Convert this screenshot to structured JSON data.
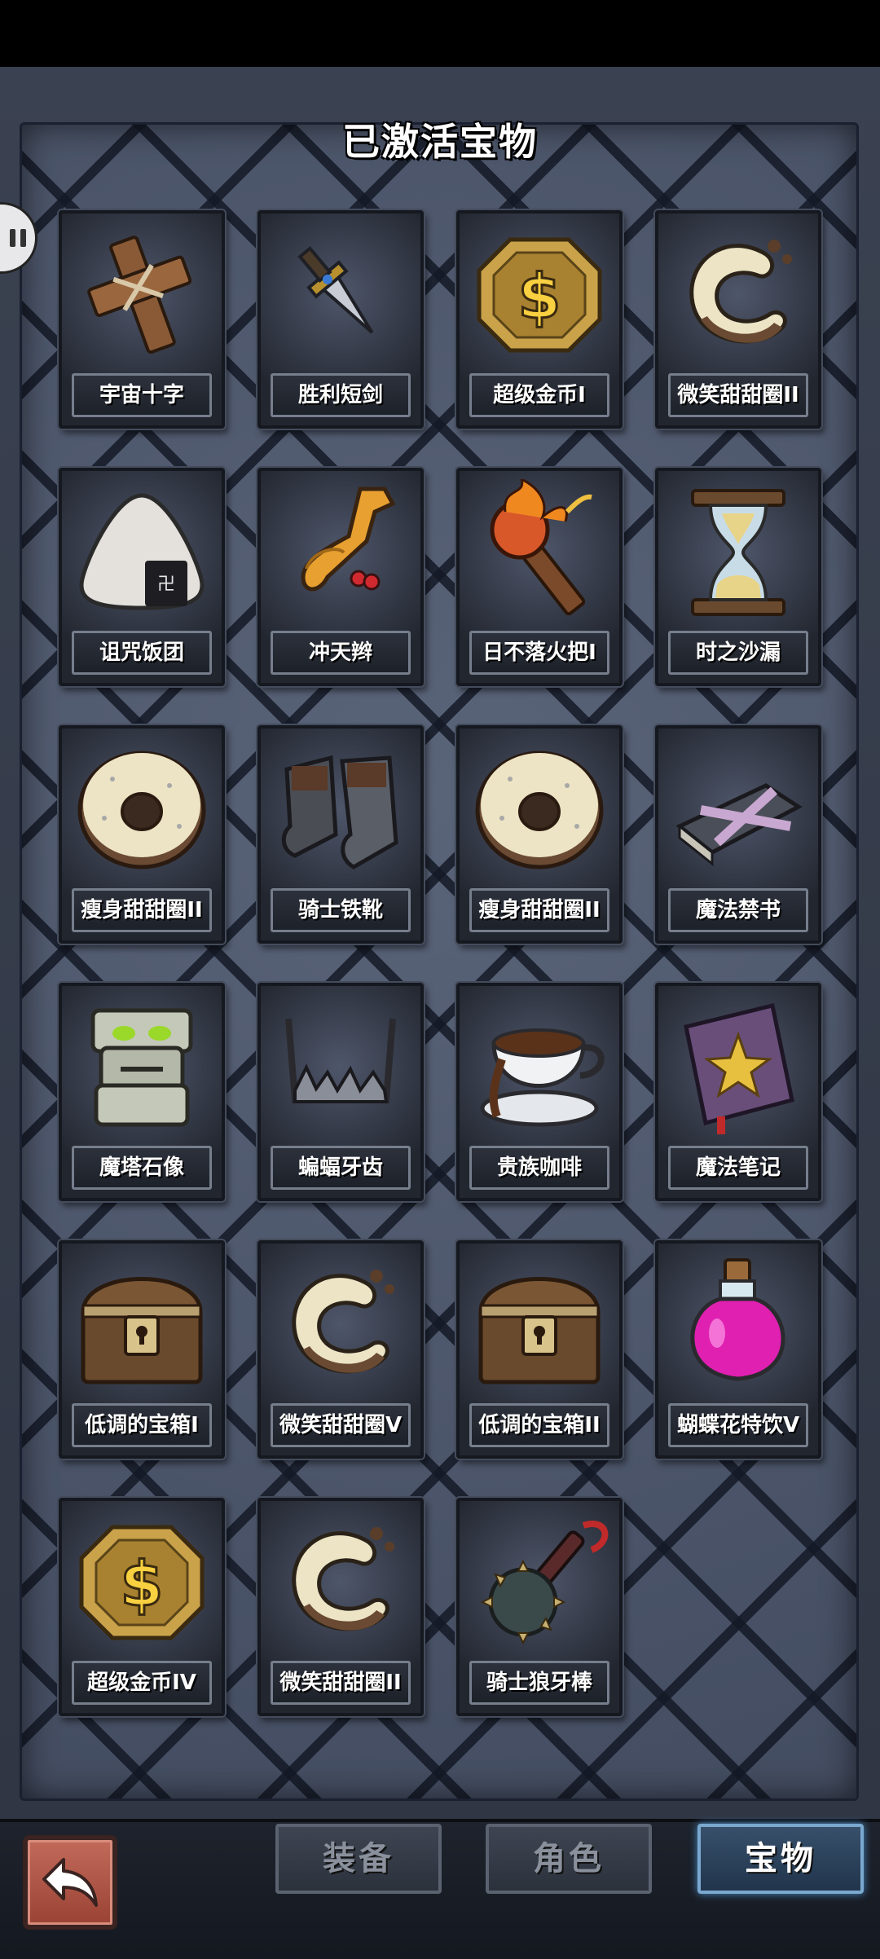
{
  "title": "已激活宝物",
  "items": [
    {
      "name": "宇宙十字",
      "icon": "wooden-cross-icon"
    },
    {
      "name": "胜利短剑",
      "icon": "dagger-icon"
    },
    {
      "name": "超级金币I",
      "icon": "gold-coin-icon"
    },
    {
      "name": "微笑甜甜圈II",
      "icon": "crescent-donut-icon"
    },
    {
      "name": "诅咒饭团",
      "icon": "rice-ball-icon"
    },
    {
      "name": "冲天辫",
      "icon": "hair-tail-icon"
    },
    {
      "name": "日不落火把I",
      "icon": "torch-icon"
    },
    {
      "name": "时之沙漏",
      "icon": "hourglass-icon"
    },
    {
      "name": "瘦身甜甜圈II",
      "icon": "donut-icon"
    },
    {
      "name": "骑士铁靴",
      "icon": "iron-boots-icon"
    },
    {
      "name": "瘦身甜甜圈II",
      "icon": "donut-icon"
    },
    {
      "name": "魔法禁书",
      "icon": "sealed-book-icon"
    },
    {
      "name": "魔塔石像",
      "icon": "stone-totem-icon"
    },
    {
      "name": "蝙蝠牙齿",
      "icon": "bat-teeth-icon"
    },
    {
      "name": "贵族咖啡",
      "icon": "coffee-cup-icon"
    },
    {
      "name": "魔法笔记",
      "icon": "magic-notebook-icon"
    },
    {
      "name": "低调的宝箱I",
      "icon": "treasure-chest-icon"
    },
    {
      "name": "微笑甜甜圈V",
      "icon": "crescent-donut-icon"
    },
    {
      "name": "低调的宝箱II",
      "icon": "treasure-chest-icon"
    },
    {
      "name": "蝴蝶花特饮V",
      "icon": "potion-bottle-icon"
    },
    {
      "name": "超级金币IV",
      "icon": "gold-coin-icon"
    },
    {
      "name": "微笑甜甜圈II",
      "icon": "crescent-donut-icon"
    },
    {
      "name": "骑士狼牙棒",
      "icon": "spiked-mace-icon"
    }
  ],
  "tabs": [
    {
      "label": "装备",
      "active": false
    },
    {
      "label": "角色",
      "active": false
    },
    {
      "label": "宝物",
      "active": true
    }
  ],
  "colors": {
    "accent": "#7aa8cf",
    "panel": "#505a70",
    "back_button": "#b05a4a"
  }
}
